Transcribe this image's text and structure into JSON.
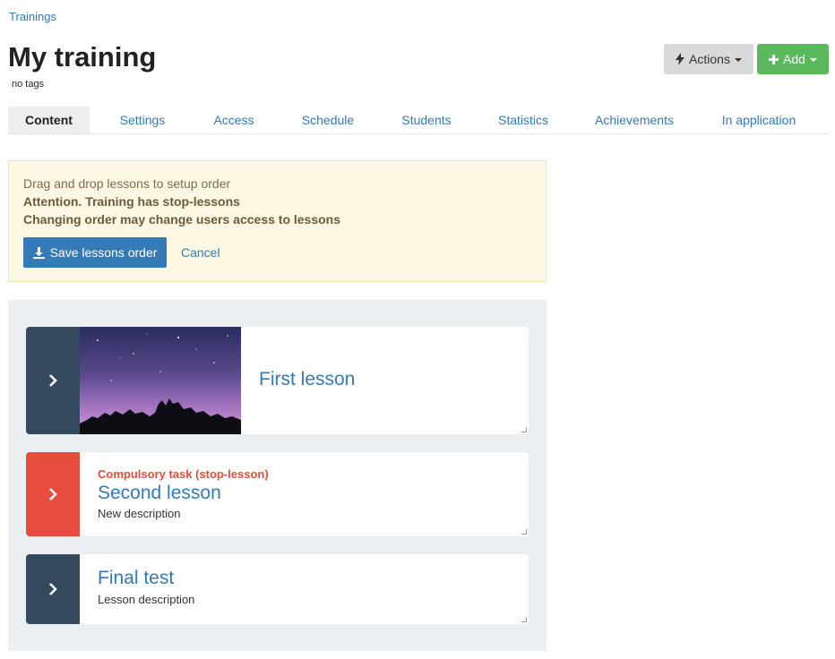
{
  "breadcrumb": "Trainings",
  "page": {
    "title": "My training",
    "tags": "no tags"
  },
  "actions": {
    "actions_label": "Actions",
    "add_label": "Add"
  },
  "tabs": [
    {
      "label": "Content",
      "active": true
    },
    {
      "label": "Settings"
    },
    {
      "label": "Access"
    },
    {
      "label": "Schedule"
    },
    {
      "label": "Students"
    },
    {
      "label": "Statistics"
    },
    {
      "label": "Achievements"
    },
    {
      "label": "In application"
    }
  ],
  "notice": {
    "line1": "Drag and drop lessons to setup order",
    "line2": "Attention. Training has stop-lessons",
    "line3": "Changing order may change users access to lessons",
    "save_label": "Save lessons order",
    "cancel_label": "Cancel"
  },
  "lessons": [
    {
      "title": "First lesson",
      "handle_color": "#34495e"
    },
    {
      "title": "Second lesson",
      "badge": "Compulsory task (stop-lesson)",
      "description": "New description",
      "handle_color": "#e74c3c"
    },
    {
      "title": "Final test",
      "description": "Lesson description",
      "handle_color": "#34495e"
    }
  ],
  "icons": {
    "actions": "lightning-bolt-icon",
    "add": "plus-icon",
    "save": "download-icon",
    "handle": "chevron-right-icon"
  },
  "colors": {
    "primary": "#337ab7",
    "success": "#5cb85c",
    "danger": "#e74c3c",
    "dark": "#34495e",
    "notice_bg": "#fcf8e3"
  }
}
